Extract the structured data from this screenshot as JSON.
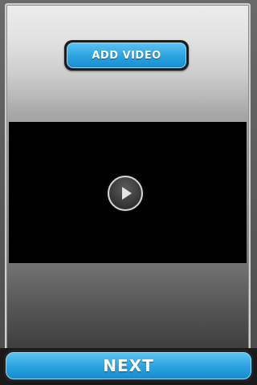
{
  "header": {
    "add_video_label": "ADD VIDEO"
  },
  "player": {
    "play_icon": "play-icon"
  },
  "footer": {
    "next_label": "NEXT"
  },
  "colors": {
    "button_blue": "#2aa2e0",
    "video_background": "#000000"
  }
}
